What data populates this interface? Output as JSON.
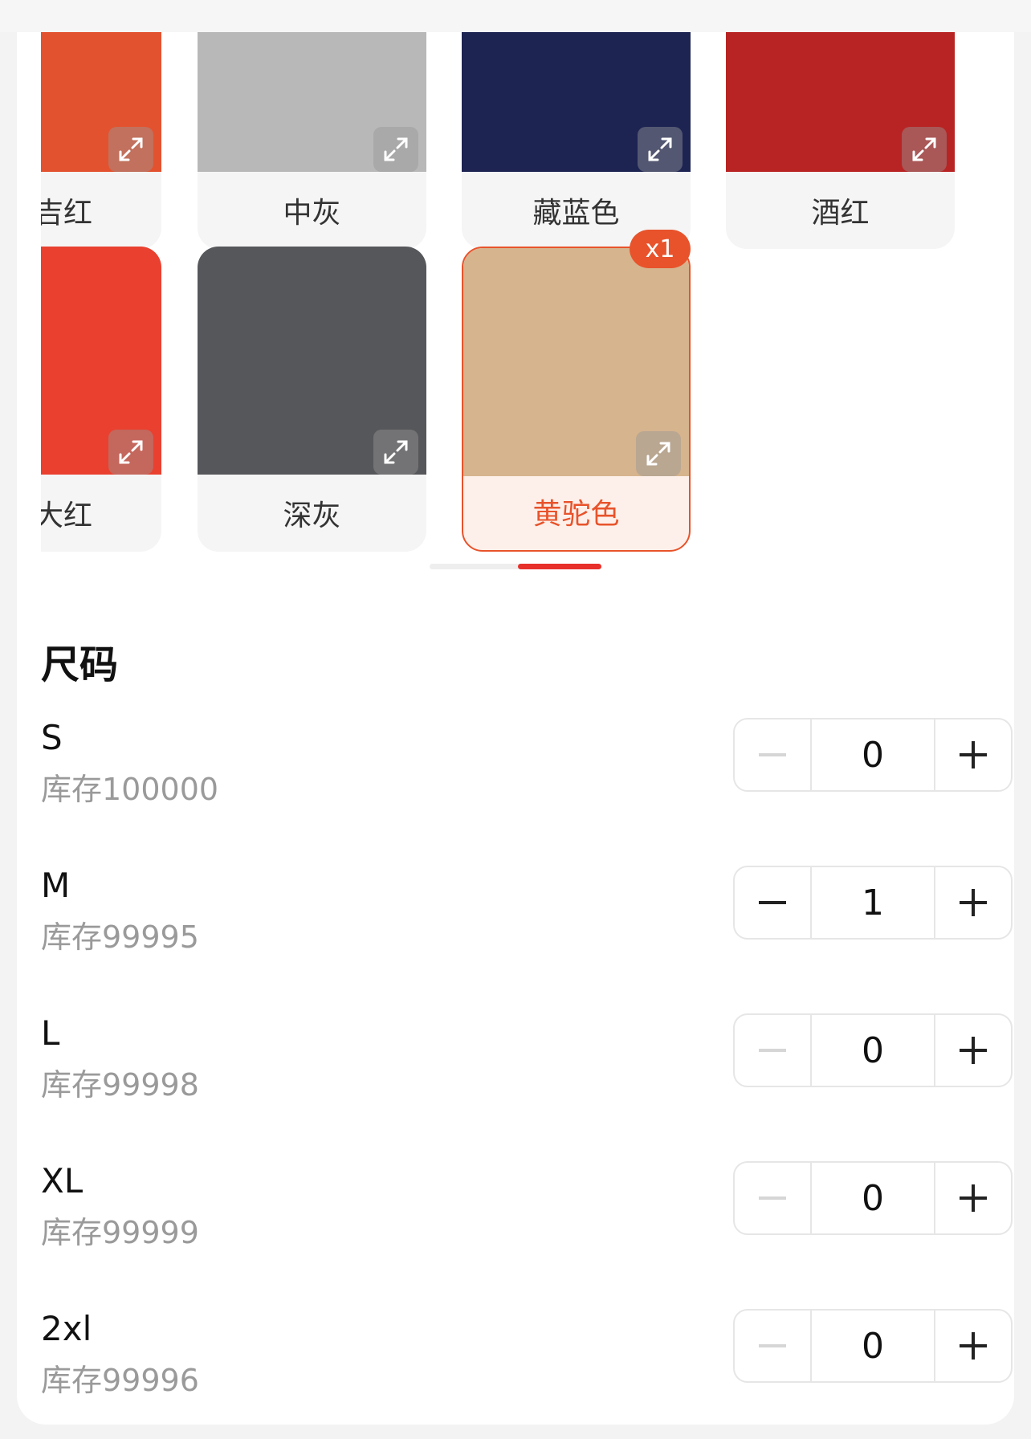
{
  "colors": {
    "accent": "#e8532b",
    "scroll_thumb": "#e8302b",
    "stock_text": "#9a9a9a"
  },
  "colors_row1": [
    {
      "label": "酒红",
      "visible_label": "ɑ红",
      "photo": "#e3522f"
    },
    {
      "label": "中灰",
      "photo": "#b8b8b8"
    },
    {
      "label": "藏蓝色",
      "photo": "#1d2452"
    },
    {
      "label": "酒红",
      "photo": "#b82424"
    }
  ],
  "colors_row2": [
    {
      "label": "大红",
      "photo": "#e9402f"
    },
    {
      "label": "深灰",
      "photo": "#56575a"
    },
    {
      "label": "黄驼色",
      "photo": "#d6b48e",
      "badge": "x1"
    }
  ],
  "row1_partial_label": "吉红",
  "row2_partial_label": "大红",
  "icons": {
    "expand": "expand-icon",
    "minus": "minus-icon",
    "plus": "plus-icon"
  },
  "size_section": {
    "title": "尺码",
    "sizes": [
      {
        "name": "S",
        "stock": "库存100000",
        "qty": "0",
        "minus_enabled": false
      },
      {
        "name": "M",
        "stock": "库存99995",
        "qty": "1",
        "minus_enabled": true
      },
      {
        "name": "L",
        "stock": "库存99998",
        "qty": "0",
        "minus_enabled": false
      },
      {
        "name": "XL",
        "stock": "库存99999",
        "qty": "0",
        "minus_enabled": false
      },
      {
        "name": "2xl",
        "stock": "库存99996",
        "qty": "0",
        "minus_enabled": false
      }
    ]
  }
}
